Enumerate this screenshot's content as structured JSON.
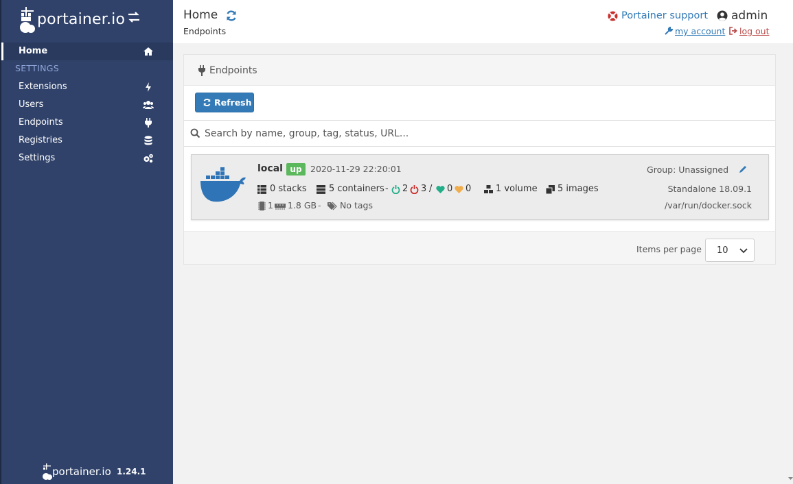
{
  "brand": {
    "name": "portainer.io",
    "version": "1.24.1"
  },
  "sidebar": {
    "home_label": "Home",
    "settings_heading": "SETTINGS",
    "items": [
      {
        "label": "Extensions",
        "icon": "bolt-icon"
      },
      {
        "label": "Users",
        "icon": "users-icon"
      },
      {
        "label": "Endpoints",
        "icon": "plug-icon"
      },
      {
        "label": "Registries",
        "icon": "database-icon"
      },
      {
        "label": "Settings",
        "icon": "cogs-icon"
      }
    ]
  },
  "header": {
    "title": "Home",
    "breadcrumb": "Endpoints",
    "support_label": "Portainer support",
    "username": "admin",
    "my_account_label": "my account",
    "logout_label": "log out"
  },
  "endpoints_widget": {
    "title": "Endpoints",
    "refresh_label": "Refresh",
    "search_placeholder": "Search by name, group, tag, status, URL...",
    "items_per_page_label": "Items per page",
    "items_per_page_value": "10",
    "endpoint": {
      "name": "local",
      "status": "up",
      "timestamp": "2020-11-29 22:20:01",
      "group": "Group: Unassigned",
      "stacks": "0 stacks",
      "containers": "5 containers",
      "running": "2",
      "stopped": "3",
      "healthy": "0",
      "unhealthy": "0",
      "volumes": "1 volume",
      "images": "5 images",
      "engine": "Standalone 18.09.1",
      "cpu": "1",
      "memory": "1.8 GB",
      "separator": "-",
      "tags": "No tags",
      "url": "/var/run/docker.sock"
    }
  },
  "colors": {
    "sidebar_bg": "#30426a",
    "primary": "#337ab7",
    "success": "#5cb85c",
    "danger": "#b94a48",
    "running": "#23ae89",
    "warning": "#f0ad4e"
  }
}
